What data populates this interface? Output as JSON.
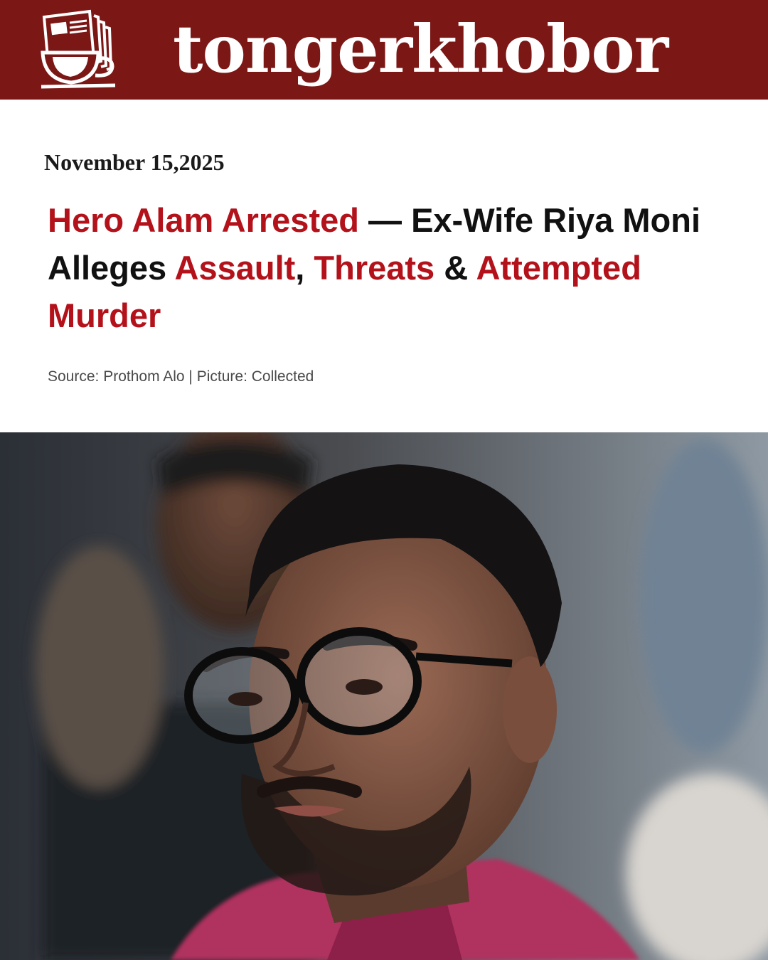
{
  "masthead": {
    "brand": "tongerkhobor",
    "logo_icon": "newspaper-coffee-cup-icon",
    "background_color": "#7b1816"
  },
  "article": {
    "date": "November 15,2025",
    "headline_segments": [
      {
        "text": "Hero Alam Arrested",
        "accent": true
      },
      {
        "text": " — Ex-Wife Riya Moni Alleges ",
        "accent": false
      },
      {
        "text": "Assault",
        "accent": true
      },
      {
        "text": ", ",
        "accent": false
      },
      {
        "text": "Threats",
        "accent": true
      },
      {
        "text": " & ",
        "accent": false
      },
      {
        "text": "Attempted Murder",
        "accent": true
      }
    ],
    "accent_color": "#b3121b",
    "source_line": "Source: Prothom Alo | Picture: Collected"
  },
  "photo": {
    "subject": "man-with-glasses-photo"
  }
}
